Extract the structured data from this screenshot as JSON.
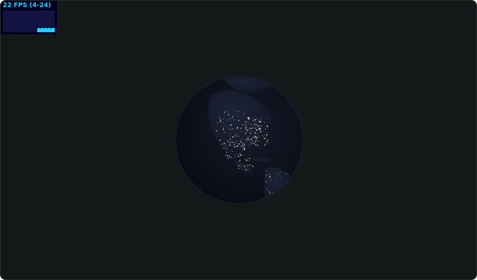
{
  "stats": {
    "fps_text": "22 FPS (4-24)",
    "graph_values": [
      21,
      22,
      23,
      22,
      21,
      22,
      23,
      24,
      22,
      21,
      22,
      23,
      22,
      22,
      21,
      23,
      24,
      22,
      22,
      21,
      22,
      23,
      22,
      24,
      22
    ]
  },
  "colors": {
    "viewport_bg": "#151819",
    "stats_text": "#1fd3ff",
    "stats_bg": "#00001f",
    "graph_bg": "#131342",
    "globe_dark": "#0a0d15",
    "city_lights": "#f4e7b8"
  },
  "globe": {
    "icon": "earth-night-globe"
  }
}
